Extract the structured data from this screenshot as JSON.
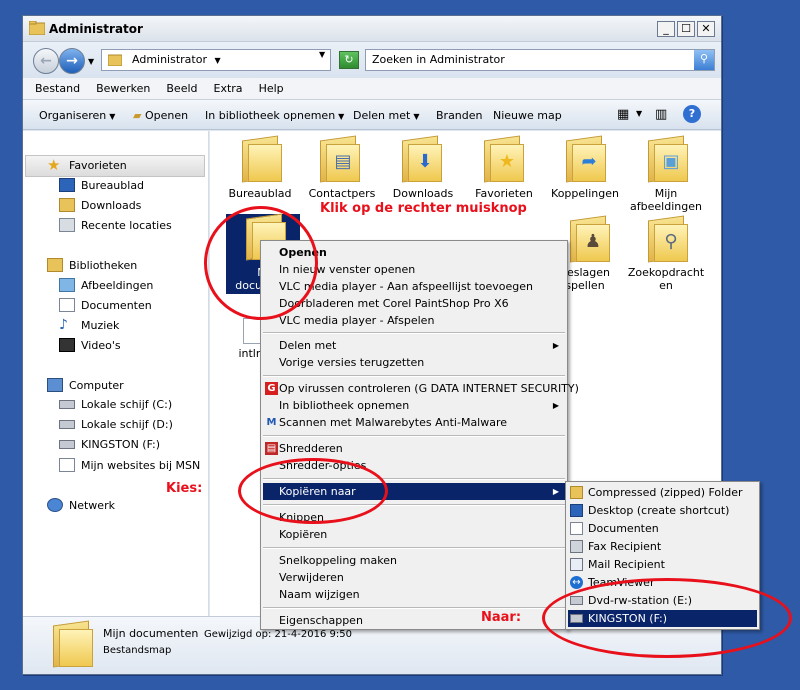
{
  "window": {
    "title": "Administrator",
    "controls": [
      "_",
      "☐",
      "✕"
    ]
  },
  "address": {
    "path": "Administrator",
    "search_placeholder": "Zoeken in Administrator"
  },
  "menubar": [
    "Bestand",
    "Bewerken",
    "Beeld",
    "Extra",
    "Help"
  ],
  "toolbar": {
    "organize": "Organiseren",
    "open": "Openen",
    "library": "In bibliotheek opnemen",
    "share": "Delen met",
    "burn": "Branden",
    "new_folder": "Nieuwe map"
  },
  "sidebar": {
    "favorites": "Favorieten",
    "desktop": "Bureaublad",
    "downloads": "Downloads",
    "recent": "Recente locaties",
    "libraries": "Bibliotheken",
    "pictures": "Afbeeldingen",
    "documents": "Documenten",
    "music": "Muziek",
    "videos": "Video's",
    "computer": "Computer",
    "drive_c": "Lokale schijf (C:)",
    "drive_d": "Lokale schijf (D:)",
    "kingston": "KINGSTON (F:)",
    "msn": "Mijn websites bij MSN",
    "network": "Netwerk"
  },
  "folders": {
    "desktop": "Bureaublad",
    "contacts": "Contactpers",
    "downloads": "Downloads",
    "favorites": "Favorieten",
    "links": "Koppelingen",
    "my_pictures_1": "Mijn",
    "my_pictures_2": "afbeeldingen",
    "my_docs_1": "M",
    "my_docs_2": "docum",
    "saved_games_1": "geslagen",
    "saved_games_2": "spellen",
    "searches_1": "Zoekopdracht",
    "searches_2": "en",
    "intlnav": "intlna"
  },
  "annotations": {
    "right_click": "Klik op de rechter muisknop",
    "choose": "Kies:",
    "to": "Naar:"
  },
  "context_menu": {
    "open": "Openen",
    "new_window": "In nieuw venster openen",
    "vlc_playlist": "VLC media player - Aan afspeellijst toevoegen",
    "corel": "Doorbladeren met Corel PaintShop Pro X6",
    "vlc_play": "VLC media player - Afspelen",
    "share": "Delen met",
    "restore": "Vorige versies terugzetten",
    "gdata": "Op virussen controleren (G DATA INTERNET SECURITY)",
    "library": "In bibliotheek opnemen",
    "malwarebytes": "Scannen met Malwarebytes Anti-Malware",
    "shred": "Shredderen",
    "shred_opts": "Shredder-opties",
    "send_to": "Kopiëren naar",
    "cut": "Knippen",
    "copy": "Kopiëren",
    "shortcut": "Snelkoppeling maken",
    "delete": "Verwijderen",
    "rename": "Naam wijzigen",
    "properties": "Eigenschappen"
  },
  "send_to_menu": {
    "zip": "Compressed (zipped) Folder",
    "desktop": "Desktop (create shortcut)",
    "documents": "Documenten",
    "fax": "Fax Recipient",
    "mail": "Mail Recipient",
    "teamviewer": "TeamViewer",
    "dvd": "Dvd-rw-station (E:)",
    "kingston": "KINGSTON (F:)"
  },
  "details": {
    "name": "Mijn documenten",
    "modified": "Gewijzigd op: 21-4-2016 9:50",
    "type": "Bestandsmap"
  }
}
